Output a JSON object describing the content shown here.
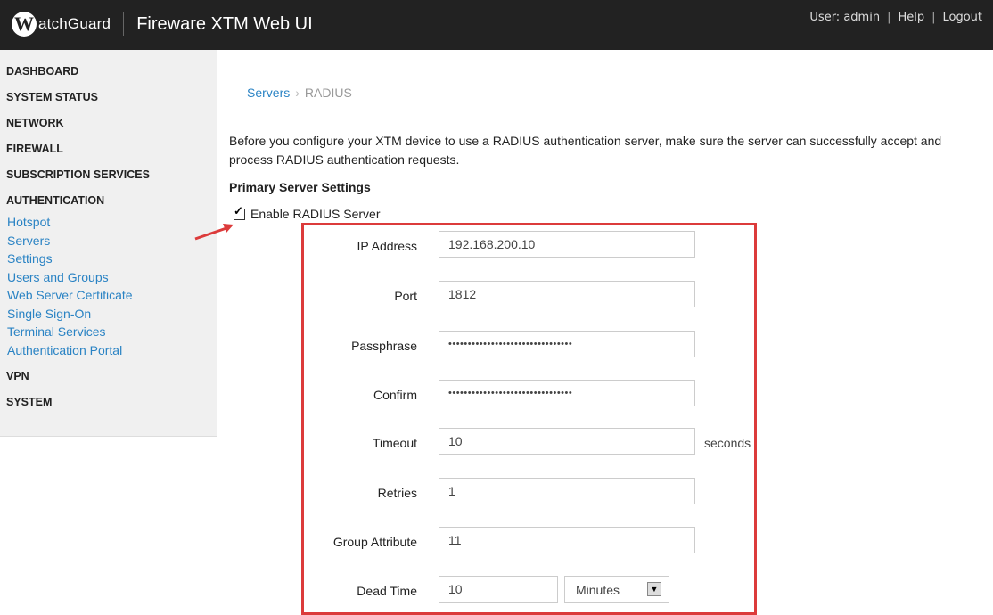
{
  "header": {
    "logo_letter": "W",
    "logo_text": "atchGuard",
    "app_title": "Fireware XTM Web UI",
    "user_label": "User: admin",
    "help_label": "Help",
    "logout_label": "Logout"
  },
  "sidebar": {
    "top_items": [
      {
        "label": "DASHBOARD"
      },
      {
        "label": "SYSTEM STATUS"
      },
      {
        "label": "NETWORK"
      },
      {
        "label": "FIREWALL"
      },
      {
        "label": "SUBSCRIPTION SERVICES"
      },
      {
        "label": "AUTHENTICATION"
      }
    ],
    "auth_items": [
      {
        "label": "Hotspot"
      },
      {
        "label": "Servers"
      },
      {
        "label": "Settings"
      },
      {
        "label": "Users and Groups"
      },
      {
        "label": "Web Server Certificate"
      },
      {
        "label": "Single Sign-On"
      },
      {
        "label": "Terminal Services"
      },
      {
        "label": "Authentication Portal"
      }
    ],
    "bottom_items": [
      {
        "label": "VPN"
      },
      {
        "label": "SYSTEM"
      }
    ]
  },
  "breadcrumb": {
    "parent": "Servers",
    "current": "RADIUS"
  },
  "intro_text": "Before you configure your XTM device to use a RADIUS authentication server, make sure the server can successfully accept and process RADIUS authentication requests.",
  "section_title": "Primary Server Settings",
  "enable_label": "Enable RADIUS Server",
  "enable_checked": true,
  "form": {
    "ip_label": "IP Address",
    "ip_value": "192.168.200.10",
    "port_label": "Port",
    "port_value": "1812",
    "passphrase_label": "Passphrase",
    "passphrase_value": "••••••••••••••••••••••••••••••••",
    "confirm_label": "Confirm",
    "confirm_value": "••••••••••••••••••••••••••••••••",
    "timeout_label": "Timeout",
    "timeout_value": "10",
    "timeout_unit": "seconds",
    "retries_label": "Retries",
    "retries_value": "1",
    "group_label": "Group Attribute",
    "group_value": "11",
    "dead_label": "Dead Time",
    "dead_value": "10",
    "dead_unit": "Minutes"
  },
  "colors": {
    "header_bg": "#222222",
    "link": "#2a83c4",
    "highlight_box": "#dc3b3b"
  }
}
